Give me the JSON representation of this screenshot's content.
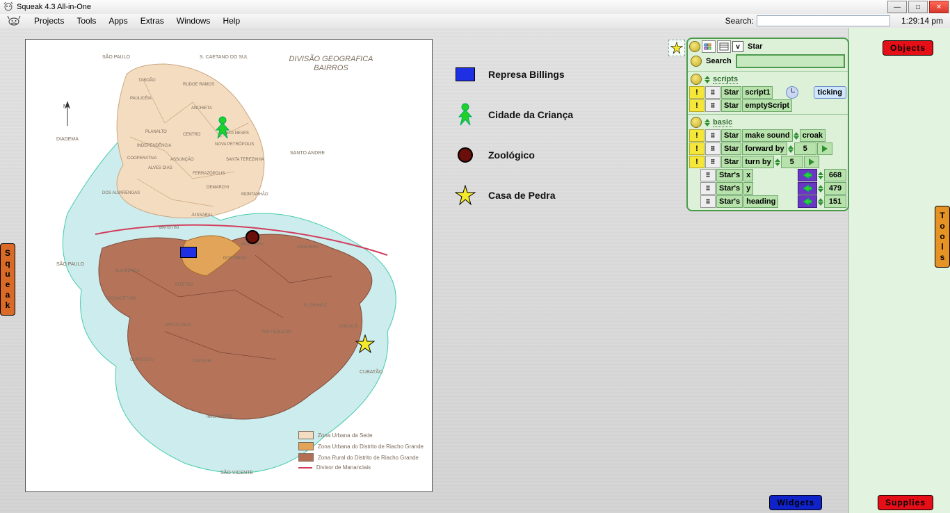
{
  "window": {
    "title": "Squeak 4.3 All-in-One",
    "buttons": {
      "min": "—",
      "max": "□",
      "close": "✕"
    }
  },
  "menubar": {
    "items": [
      "Projects",
      "Tools",
      "Apps",
      "Extras",
      "Windows",
      "Help"
    ],
    "search_label": "Search:",
    "clock": "1:29:14 pm"
  },
  "flaps": {
    "squeak": "Squeak",
    "tools": "Tools",
    "objects": "Objects",
    "widgets": "Widgets",
    "supplies": "Supplies"
  },
  "map": {
    "title_line1": "DIVISÃO GEOGRAFICA",
    "title_line2": "BAIRROS",
    "outer_labels": {
      "nw": "SÃO PAULO",
      "ne": "S. CAETANO DO SUL",
      "e": "SANTO ANDRE",
      "w_upper": "DIADEMA",
      "w_lower": "SÃO PAULO",
      "se": "CUBATÃO",
      "s": "SÃO VICENTE"
    },
    "inner_labels": {
      "taboao": "TABOÃO",
      "pauliceia": "PAULICÉIA",
      "planaltoi": "PLANALTO",
      "centroi": "CENTRO",
      "baetaneves": "BAETA NEVES",
      "anchietai": "ANCHIETA",
      "rudge": "RUDGE RAMOS",
      "novap": "NOVA PETRÓPOLIS",
      "assuncao": "ASSUNÇÃO",
      "alvarenga": "DOS ALVARENGAS",
      "alves": "ALVES DIAS",
      "cooper": "COOPERATIVA",
      "indep": "INDEPENDÊNCIA",
      "stereza": "SANTA TEREZINHA",
      "ferraz": "FERRAZÓPOLIS",
      "demarchi": "DEMARCHI",
      "montanhao": "MONTANHÃO",
      "batistini": "BATISTINI",
      "dosfinos": "DOS FINOS",
      "botujuru": "BOTUJURU",
      "alvarenga2": "ALVARENGA",
      "tatetos": "TATETOS",
      "scruz": "SANTA CRUZ",
      "curucutu": "CURUCUTU",
      "capivari": "CAPIVARI",
      "riopeq": "RIO PEQUENO",
      "varginha": "VARGINHA",
      "taquacetuba": "TAQUACETUBA",
      "imigrantes": "IMIGRANTES",
      "rgrande": "R. GRANDE",
      "jussaral": "JUSSARAL",
      "zanzala": "ZANZALÁ"
    },
    "zone_legend": {
      "z1": "Zona Urbana da Sede",
      "z2": "Zona Urbana do Distrito de Riacho Grande",
      "z3": "Zona Rural do Distrito de Riacho Grande",
      "div": "Divisor de Mananciais"
    }
  },
  "poi_legend": {
    "billings": "Represa Billings",
    "crianca": "Cidade da Criança",
    "zoo": "Zoológico",
    "pedra": "Casa de Pedra"
  },
  "colors": {
    "zone1": "#f4dcc0",
    "zone2": "#e2a458",
    "zone3": "#b46e53",
    "water": "#cdeced",
    "divider": "#d23d5c"
  },
  "viewer": {
    "object": "Star",
    "v_label": "v",
    "search_label": "Search",
    "cat_scripts": "scripts",
    "cat_basic": "basic",
    "scripts": [
      {
        "obj": "Star",
        "name": "script1",
        "status": "ticking"
      },
      {
        "obj": "Star",
        "name": "emptyScript"
      }
    ],
    "basic_cmds": [
      {
        "obj": "Star",
        "cmd": "make sound",
        "arg": "croak"
      },
      {
        "obj": "Star",
        "cmd": "forward by",
        "arg": "5"
      },
      {
        "obj": "Star",
        "cmd": "turn by",
        "arg": "5"
      }
    ],
    "basic_props": [
      {
        "obj": "Star's",
        "prop": "x",
        "val": "668"
      },
      {
        "obj": "Star's",
        "prop": "y",
        "val": "479"
      },
      {
        "obj": "Star's",
        "prop": "heading",
        "val": "151"
      }
    ]
  }
}
